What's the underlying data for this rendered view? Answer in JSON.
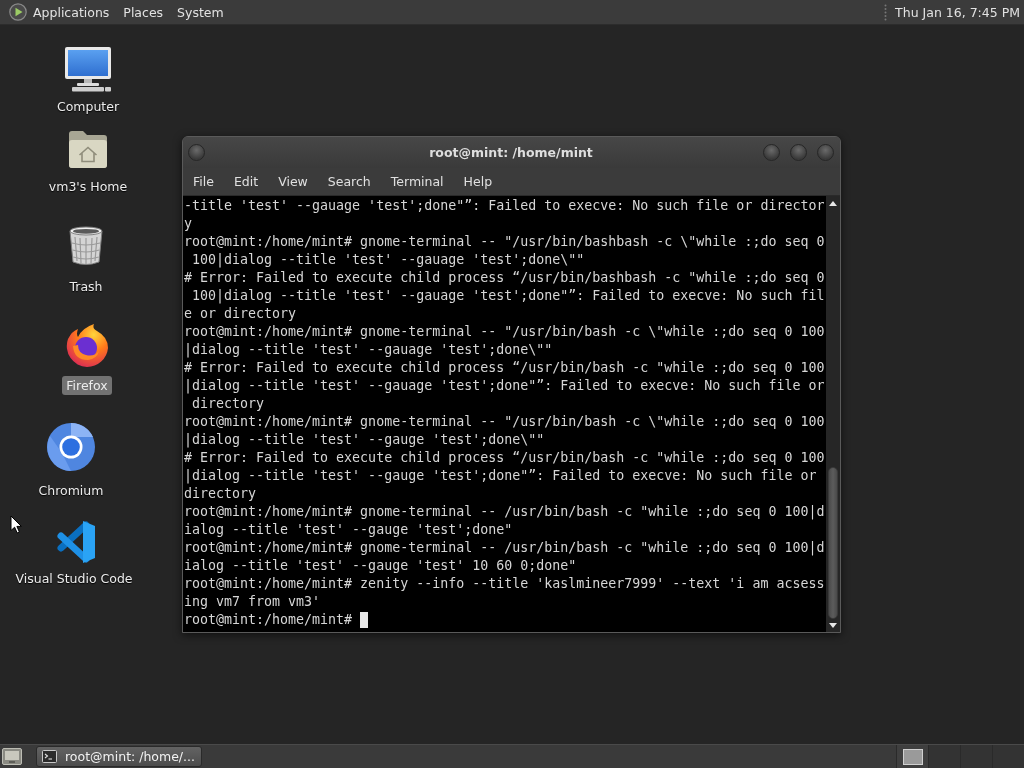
{
  "top_panel": {
    "menus": [
      "Applications",
      "Places",
      "System"
    ],
    "clock": "Thu Jan 16, 7:45 PM"
  },
  "desktop_icons": [
    {
      "label": "Computer",
      "kind": "computer",
      "selected": false
    },
    {
      "label": "vm3's Home",
      "kind": "home",
      "selected": false
    },
    {
      "label": "Trash",
      "kind": "trash",
      "selected": false
    },
    {
      "label": "Firefox",
      "kind": "firefox",
      "selected": true
    },
    {
      "label": "Chromium",
      "kind": "chromium",
      "selected": false
    },
    {
      "label": "Visual Studio Code",
      "kind": "vscode",
      "selected": false
    }
  ],
  "terminal_window": {
    "title": "root@mint: /home/mint",
    "menu": [
      "File",
      "Edit",
      "View",
      "Search",
      "Terminal",
      "Help"
    ],
    "lines": [
      "-title 'test' --gauage 'test';done\"”: Failed to execve: No such file or director",
      "y",
      "root@mint:/home/mint# gnome-terminal -- \"/usr/bin/bashbash -c \\\"while :;do seq 0",
      " 100|dialog --title 'test' --gauage 'test';done\\\"\"",
      "# Error: Failed to execute child process “/usr/bin/bashbash -c \"while :;do seq 0",
      " 100|dialog --title 'test' --gauage 'test';done\"”: Failed to execve: No such fil",
      "e or directory",
      "root@mint:/home/mint# gnome-terminal -- \"/usr/bin/bash -c \\\"while :;do seq 0 100",
      "|dialog --title 'test' --gauage 'test';done\\\"\"",
      "# Error: Failed to execute child process “/usr/bin/bash -c \"while :;do seq 0 100",
      "|dialog --title 'test' --gauage 'test';done\"”: Failed to execve: No such file or",
      " directory",
      "root@mint:/home/mint# gnome-terminal -- \"/usr/bin/bash -c \\\"while :;do seq 0 100",
      "|dialog --title 'test' --gauge 'test';done\\\"\"",
      "# Error: Failed to execute child process “/usr/bin/bash -c \"while :;do seq 0 100",
      "|dialog --title 'test' --gauge 'test';done\"”: Failed to execve: No such file or",
      "directory",
      "root@mint:/home/mint# gnome-terminal -- /usr/bin/bash -c \"while :;do seq 0 100|d",
      "ialog --title 'test' --gauge 'test';done\"",
      "root@mint:/home/mint# gnome-terminal -- /usr/bin/bash -c \"while :;do seq 0 100|d",
      "ialog --title 'test' --gauge 'test' 10 60 0;done\"",
      "root@mint:/home/mint# zenity --info --title 'kaslmineer7999' --text 'i am acsess",
      "ing vm7 from vm3'"
    ],
    "prompt": "root@mint:/home/mint#"
  },
  "taskbar": {
    "windows": [
      {
        "label": "root@mint: /home/...",
        "selected": true
      }
    ]
  }
}
